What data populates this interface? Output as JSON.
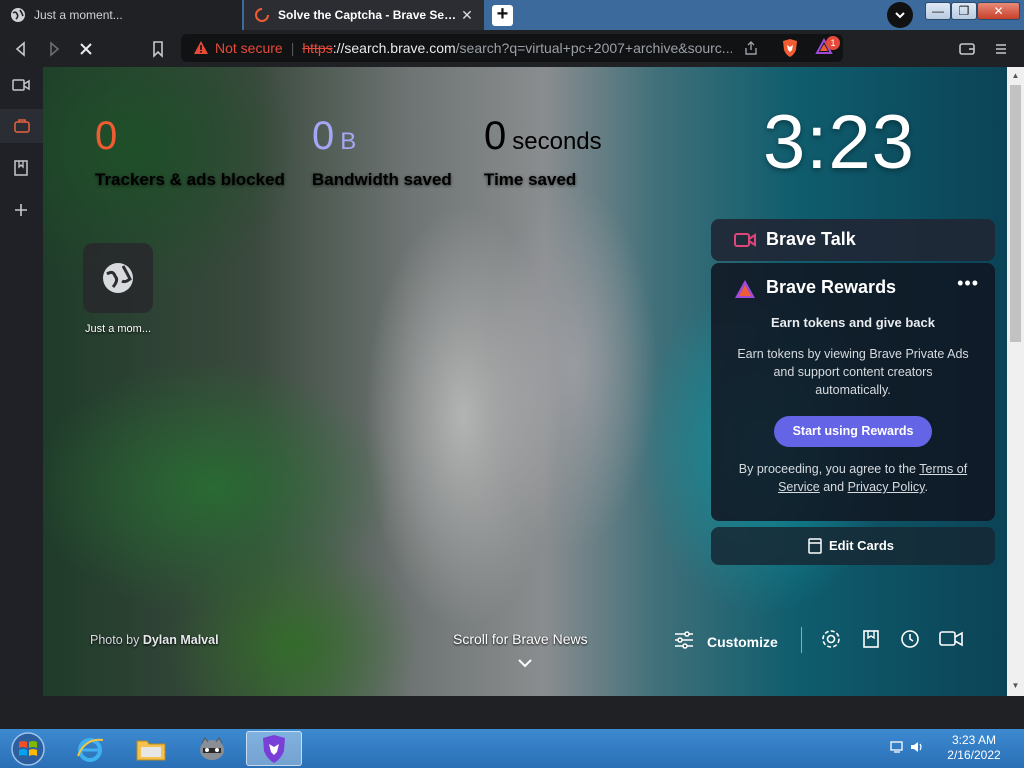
{
  "tabs": [
    {
      "title": "Just a moment...",
      "active": false
    },
    {
      "title": "Solve the Captcha - Brave Search",
      "active": true
    }
  ],
  "window_controls": {
    "minimize": "—",
    "maximize": "❐",
    "close": "✕"
  },
  "urlbar": {
    "security_label": "Not secure",
    "scheme": "https",
    "host": "://search.brave.com",
    "path": "/search?q=virtual+pc+2007+archive&sourc..."
  },
  "shields_badge": "1",
  "stats": {
    "trackers": {
      "value": "0",
      "label": "Trackers & ads blocked"
    },
    "bandwidth": {
      "value": "0",
      "unit": "B",
      "label": "Bandwidth saved"
    },
    "time": {
      "value": "0",
      "unit": "seconds",
      "label": "Time saved"
    }
  },
  "clock": "3:23",
  "top_site": {
    "label": "Just a mom..."
  },
  "brave_talk": {
    "title": "Brave Talk"
  },
  "brave_rewards": {
    "title": "Brave Rewards",
    "more": "•••",
    "heading": "Earn tokens and give back",
    "description": "Earn tokens by viewing Brave Private Ads and support content creators automatically.",
    "cta": "Start using Rewards",
    "legal_prefix": "By proceeding, you agree to the",
    "terms_link": "Terms of Service",
    "and": "and",
    "privacy_link": "Privacy Policy",
    "legal_suffix": "."
  },
  "edit_cards": {
    "label": "Edit Cards"
  },
  "photo_credit": {
    "prefix": "Photo by",
    "author": "Dylan Malval"
  },
  "scroll_news": "Scroll for Brave News",
  "customize": {
    "label": "Customize"
  },
  "taskbar": {
    "time": "3:23 AM",
    "date": "2/16/2022"
  },
  "colors": {
    "brave_orange": "#f25c33",
    "rewards_purple": "#6464e6",
    "not_secure_red": "#e84a3a"
  }
}
